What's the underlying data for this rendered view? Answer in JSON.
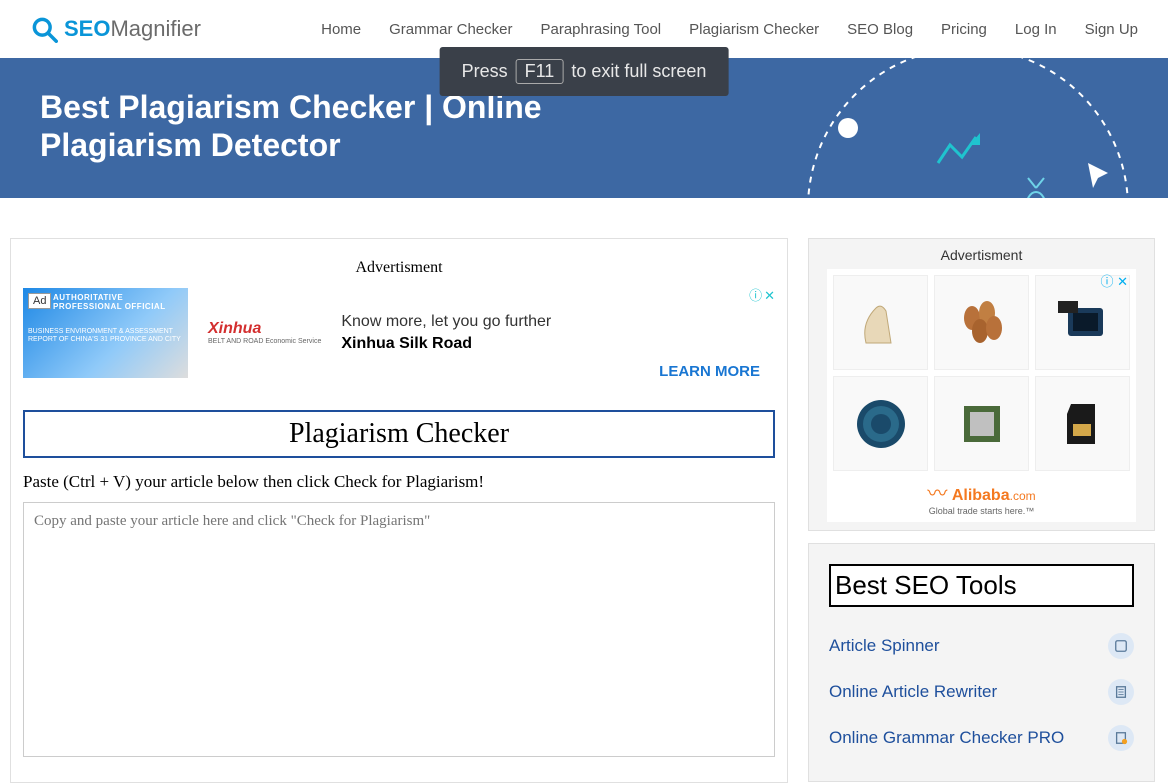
{
  "logo": {
    "seo": "SEO",
    "mag": "Magnifier"
  },
  "nav": [
    "Home",
    "Grammar Checker",
    "Paraphrasing Tool",
    "Plagiarism Checker",
    "SEO Blog",
    "Pricing",
    "Log In",
    "Sign Up"
  ],
  "fullscreen": {
    "pre": "Press",
    "key": "F11",
    "post": "to exit full screen"
  },
  "hero": {
    "title": "Best Plagiarism Checker | Online Plagiarism Detector"
  },
  "main": {
    "ad_label": "Advertisment",
    "ad": {
      "badge": "Ad",
      "img_headline": "AUTHORITATIVE PROFESSIONAL OFFICIAL",
      "img_sub": "BUSINESS ENVIRONMENT & ASSESSMENT REPORT OF CHINA'S 31 PROVINCE AND CITY",
      "brand": "Xinhua",
      "brand_sub": "BELT AND ROAD Economic Service",
      "line1": "Know more, let you go further",
      "line2": "Xinhua Silk Road",
      "learn_more": "LEARN MORE"
    },
    "tool_title": "Plagiarism Checker",
    "instruction": "Paste (Ctrl + V) your article below then click Check for Plagiarism!",
    "placeholder": "Copy and paste your article here and click \"Check for Plagiarism\""
  },
  "sidebar": {
    "ad_label": "Advertisment",
    "alibaba": {
      "name": "Alibaba",
      "suffix": ".com",
      "tag": "Global trade starts here.™"
    },
    "tools_heading": "Best SEO Tools",
    "tools": [
      {
        "label": "Article Spinner"
      },
      {
        "label": "Online Article Rewriter"
      },
      {
        "label": "Online Grammar Checker PRO"
      }
    ]
  }
}
